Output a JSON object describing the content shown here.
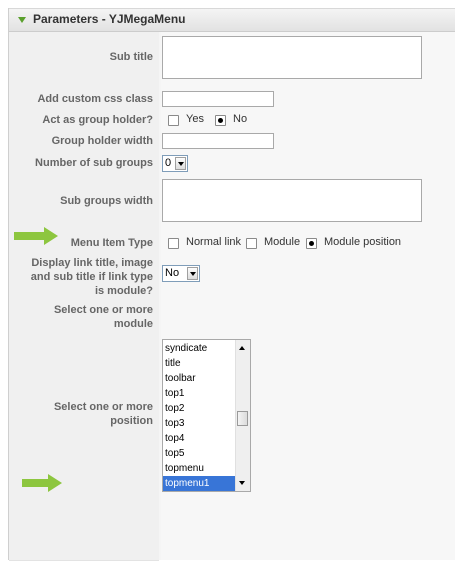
{
  "panel": {
    "title": "Parameters - YJMegaMenu",
    "rows": {
      "sub_title": {
        "label": "Sub title",
        "value": ""
      },
      "css_class": {
        "label": "Add custom css class",
        "value": ""
      },
      "group_holder": {
        "label": "Act as group holder?",
        "options": [
          "Yes",
          "No"
        ],
        "selected": "No"
      },
      "group_holder_width": {
        "label": "Group holder width",
        "value": ""
      },
      "num_sub_groups": {
        "label": "Number of sub groups",
        "selected": "0"
      },
      "sub_groups_width": {
        "label": "Sub groups width",
        "value": ""
      },
      "menu_item_type": {
        "label": "Menu Item Type",
        "options": [
          "Normal link",
          "Module",
          "Module position"
        ],
        "selected": "Module position"
      },
      "display_link": {
        "label_lines": [
          "Display link title, image",
          "and sub title if link type",
          "is module?"
        ],
        "selected": "No"
      },
      "select_module": {
        "label_lines": [
          "Select one or more",
          "module"
        ]
      },
      "select_position": {
        "label_lines": [
          "Select one or more",
          "position"
        ],
        "options": [
          "syndicate",
          "title",
          "toolbar",
          "top1",
          "top2",
          "top3",
          "top4",
          "top5",
          "topmenu",
          "topmenu1"
        ],
        "selected": "topmenu1"
      }
    }
  },
  "colors": {
    "arrow": "#8dc63f",
    "selection": "#3875d7",
    "header_icon": "#5aa02c"
  },
  "icons": {
    "header_toggle": "triangle-down-icon",
    "annotation": "green-arrow-icon"
  }
}
